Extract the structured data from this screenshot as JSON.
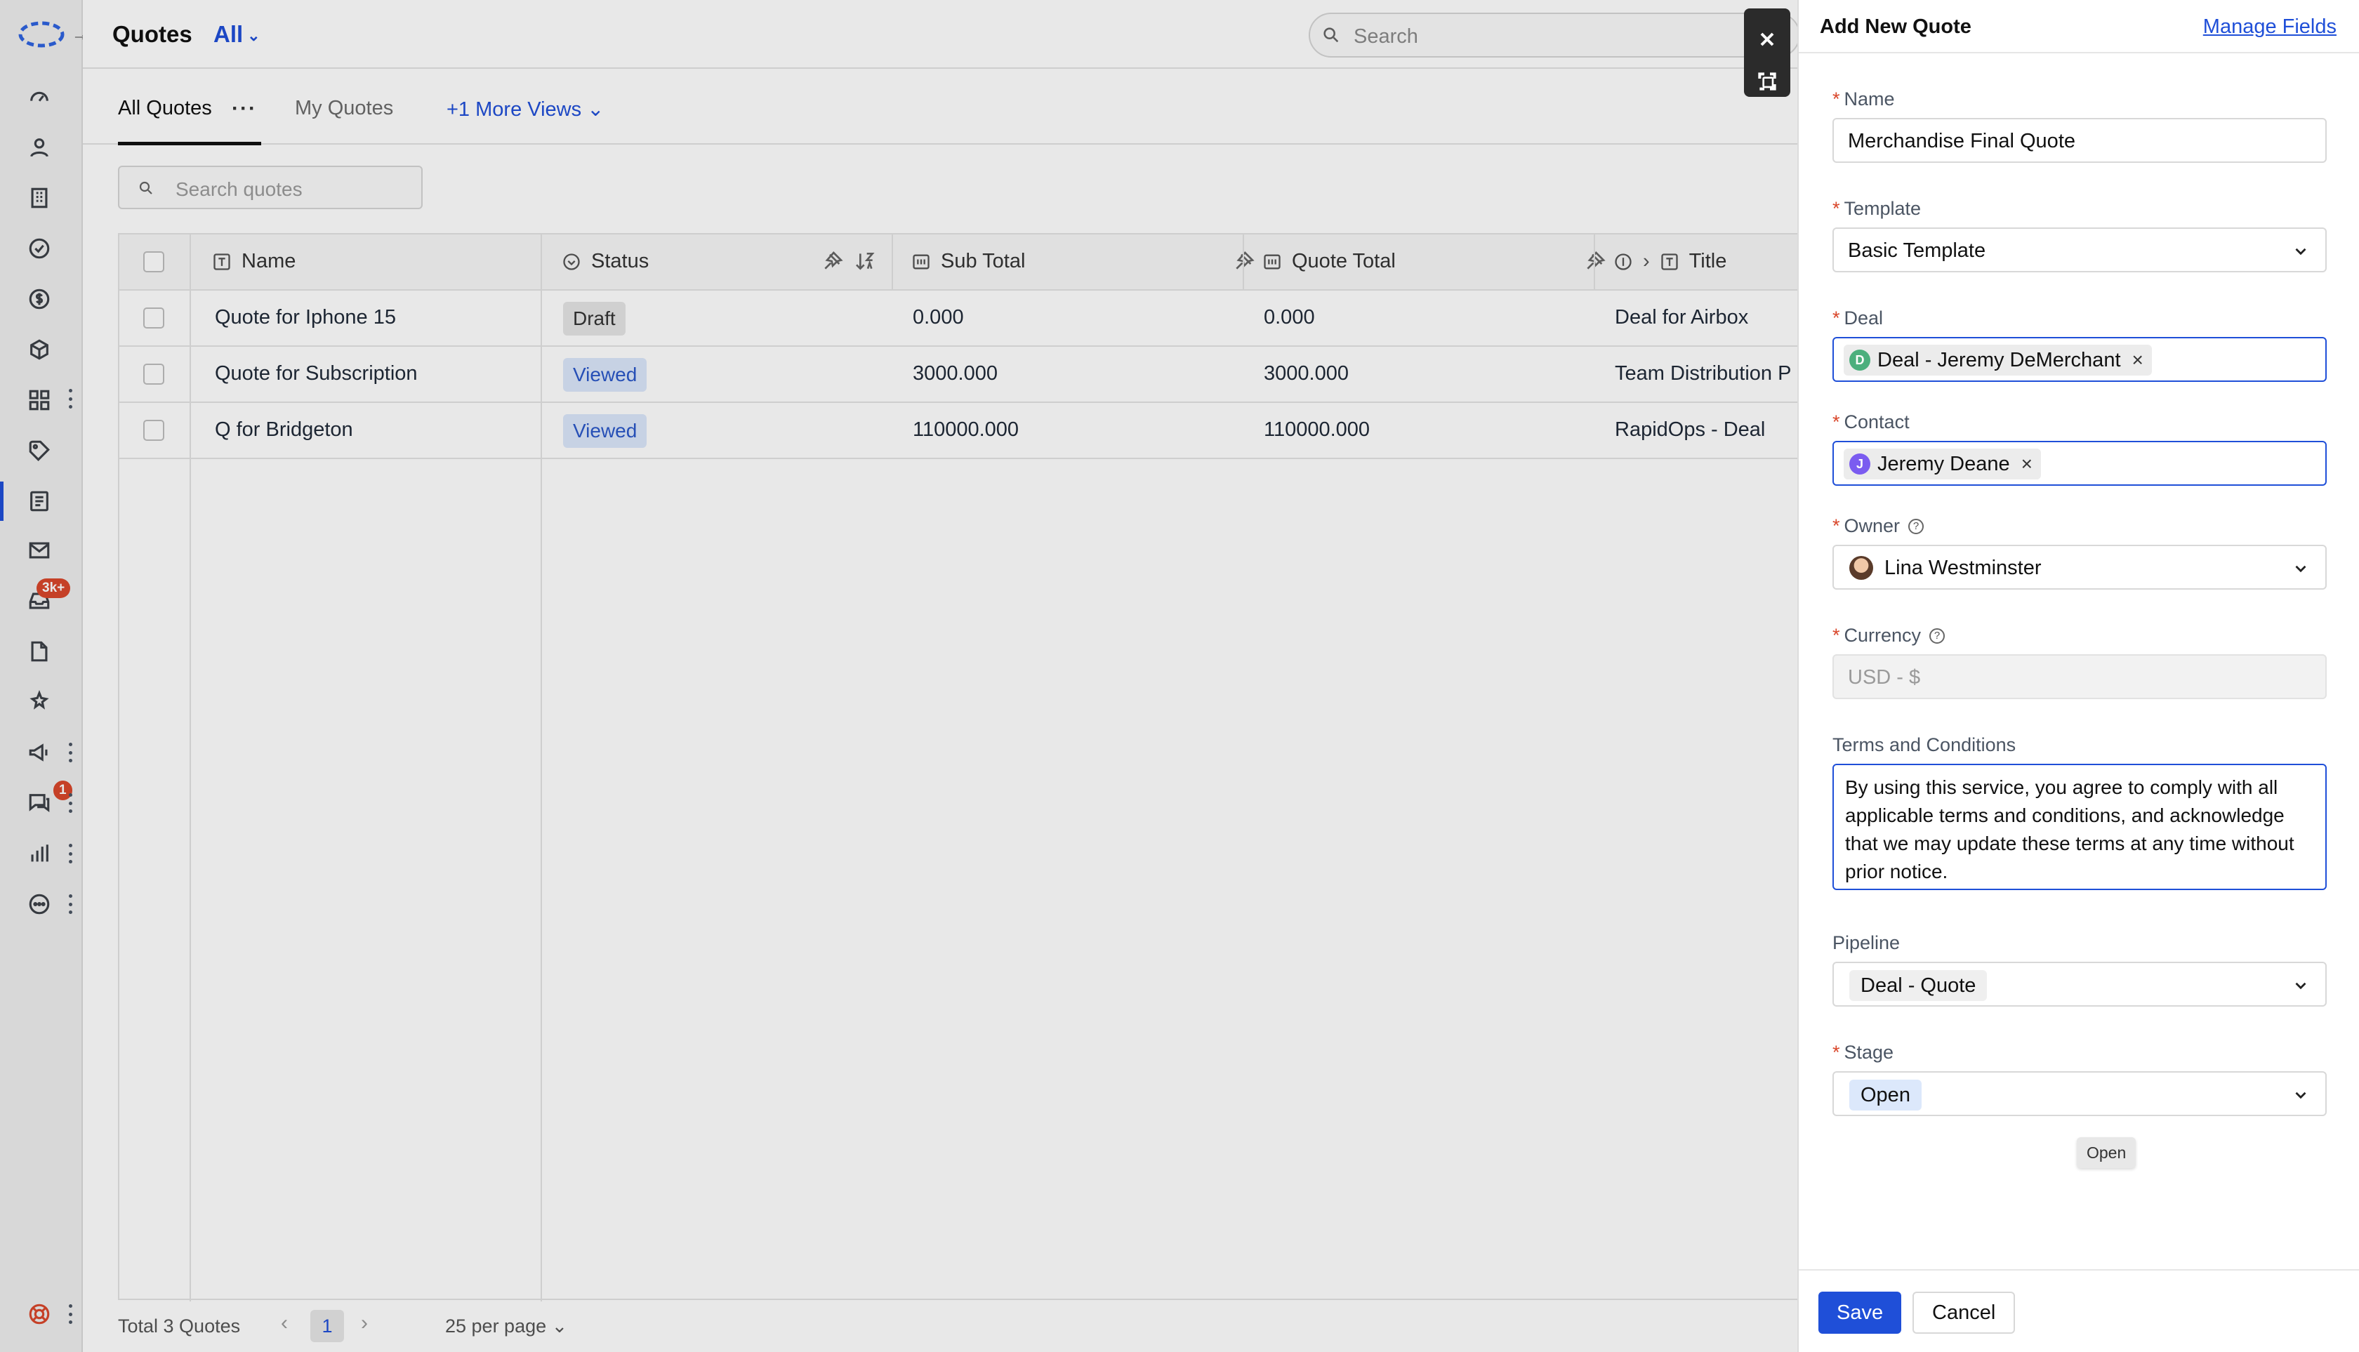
{
  "header": {
    "title": "Quotes",
    "filter": "All",
    "search_placeholder": "Search"
  },
  "tabs": [
    {
      "label": "All Quotes"
    },
    {
      "label": "My Quotes"
    },
    {
      "label": "+1 More Views"
    }
  ],
  "list_search_placeholder": "Search quotes",
  "table": {
    "columns": [
      "Name",
      "Status",
      "Sub Total",
      "Quote Total",
      "Title"
    ],
    "rows": [
      {
        "name": "Quote for Iphone 15",
        "status": "Draft",
        "sub_total": "0.000",
        "quote_total": "0.000",
        "title": "Deal for Airbox"
      },
      {
        "name": "Quote for Subscription",
        "status": "Viewed",
        "sub_total": "3000.000",
        "quote_total": "3000.000",
        "title": "Team Distribution P"
      },
      {
        "name": "Q for Bridgeton",
        "status": "Viewed",
        "sub_total": "110000.000",
        "quote_total": "110000.000",
        "title": "RapidOps - Deal"
      }
    ]
  },
  "footer": {
    "total": "Total 3 Quotes",
    "page": "1",
    "per_page": "25 per page"
  },
  "nav": {
    "inbox_badge": "3k+",
    "chat_badge": "1"
  },
  "drawer": {
    "title": "Add New Quote",
    "manage_fields": "Manage Fields",
    "name_label": "Name",
    "name_value": "Merchandise Final Quote",
    "template_label": "Template",
    "template_value": "Basic Template",
    "deal_label": "Deal",
    "deal_value": "Deal - Jeremy DeMerchant",
    "deal_initial": "D",
    "contact_label": "Contact",
    "contact_value": "Jeremy Deane",
    "contact_initial": "J",
    "owner_label": "Owner",
    "owner_value": "Lina Westminster",
    "currency_label": "Currency",
    "currency_value": "USD - $",
    "terms_label": "Terms and Conditions",
    "terms_value": "By using this service, you agree to comply with all applicable terms and conditions, and acknowledge that we may update these terms at any time without prior notice.",
    "pipeline_label": "Pipeline",
    "pipeline_value": "Deal - Quote",
    "stage_label": "Stage",
    "stage_value": "Open",
    "tooltip": "Open",
    "save": "Save",
    "cancel": "Cancel",
    "required_mark": "*"
  },
  "colors": {
    "accent": "#1f4fd8",
    "badge_red": "#d9472b",
    "viewed_bg": "#dbe7fb",
    "deal_avatar": "#4caf7d",
    "contact_avatar": "#7b5cf0"
  }
}
